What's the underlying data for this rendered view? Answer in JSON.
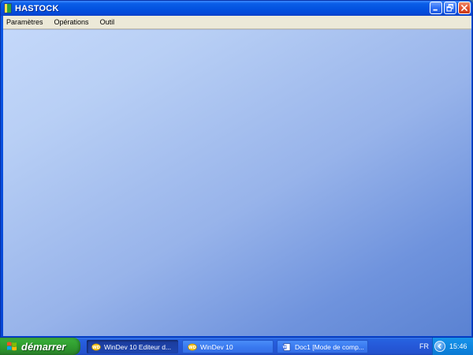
{
  "window": {
    "title": "HASTOCK"
  },
  "menu": {
    "items": [
      {
        "label": "Paramètres"
      },
      {
        "label": "Opérations"
      },
      {
        "label": "Outil"
      }
    ]
  },
  "taskbar": {
    "start_label": "démarrer",
    "tasks": [
      {
        "label": "WinDev 10  Editeur d...",
        "icon": "windev-icon",
        "active": true
      },
      {
        "label": "WinDev 10",
        "icon": "windev-icon",
        "active": false
      },
      {
        "label": "Doc1 [Mode de comp...",
        "icon": "word-document-icon",
        "active": false
      }
    ],
    "language": "FR",
    "clock": "15:46"
  },
  "colors": {
    "titlebar": "#0352e0",
    "menubar": "#ece9d8",
    "desktop_light": "#c4d8fa",
    "desktop_dark": "#5a82d2",
    "start_green": "#36a936",
    "taskbar_blue": "#2558d8",
    "close_red": "#e2532e"
  }
}
